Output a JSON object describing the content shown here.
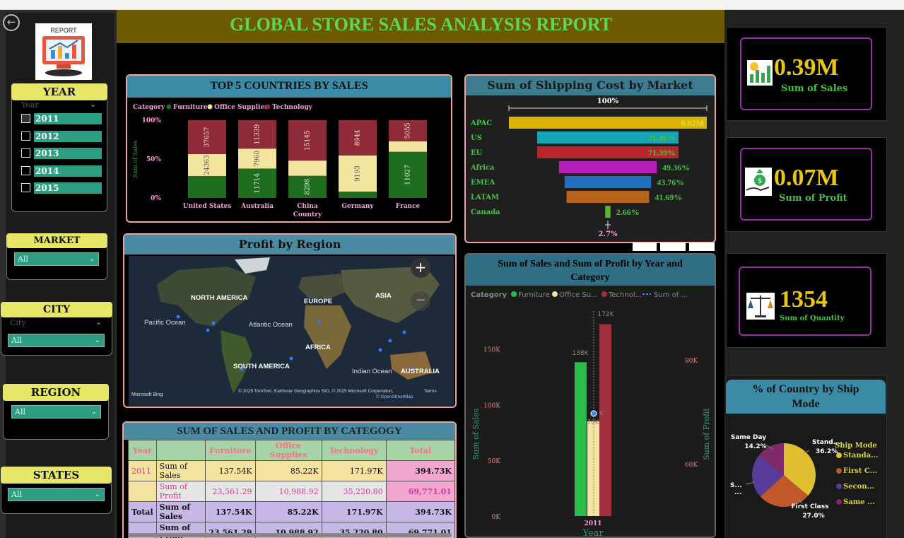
{
  "report_title": "GLOBAL STORE SALES ANALYSIS REPORT",
  "logo_text": "REPORT",
  "slicers": {
    "year": {
      "title": "YEAR",
      "placeholder": "Year",
      "options": [
        "2011",
        "2012",
        "2013",
        "2014",
        "2015"
      ]
    },
    "market": {
      "title": "MARKET",
      "value": "All"
    },
    "city": {
      "title": "CITY",
      "placeholder": "City",
      "value": "All"
    },
    "region": {
      "title": "REGION",
      "value": "All"
    },
    "states": {
      "title": "STATES",
      "value": "All"
    }
  },
  "top5": {
    "title": "TOP 5 COUNTRIES BY SALES",
    "legend_label": "Category",
    "legend": [
      {
        "name": "Furniture",
        "color": "#1f6e1f"
      },
      {
        "name": "Office Supplies",
        "color": "#f3e4a0"
      },
      {
        "name": "Technology",
        "color": "#8f2a38"
      }
    ],
    "ylabel": "Sum of Sales",
    "xlabel": "Country",
    "yticks": [
      "100%",
      "50%",
      "0%"
    ]
  },
  "shipping": {
    "title": "Sum of Shipping Cost by Market",
    "top_label": "100%",
    "bottom_label": "2.7%"
  },
  "map": {
    "title": "Profit by Region",
    "labels": {
      "north_america": "NORTH AMERICA",
      "europe": "EUROPE",
      "asia": "ASIA",
      "pacific": "Pacific Ocean",
      "atlantic": "Atlantic Ocean",
      "africa": "AFRICA",
      "south_america": "SOUTH AMERICA",
      "indian": "Indian Ocean",
      "australia": "AUSTRALIA"
    },
    "attribution": "© 2025 TomTom, Earthstar Geographics SIO, © 2025 Microsoft Corporation,",
    "terms": "Terms",
    "osm": "© OpenStreetMap",
    "brand": "Microsoft Bing",
    "zoom_in": "+",
    "zoom_out": "−"
  },
  "combo": {
    "title": "Sum of Sales and Sum of Profit by Year and Category",
    "legend_label": "Category",
    "legend": [
      {
        "name": "Furniture",
        "color": "#2bbd4a"
      },
      {
        "name": "Office Su...",
        "color": "#f3e4a0"
      },
      {
        "name": "Technol...",
        "color": "#a0303c"
      },
      {
        "name": "Sum of ...",
        "color": "#3a8ef0"
      }
    ],
    "yleft_label": "Sum of Sales",
    "yright_label": "Sum of Profit",
    "yleft_ticks": [
      "150K",
      "100K",
      "50K",
      "0K"
    ],
    "yright_ticks": [
      "80K",
      "60K"
    ],
    "bar_labels": [
      "138K",
      "70K",
      "172K",
      "K"
    ],
    "x_tick": "2011",
    "xlabel": "Year"
  },
  "matrix": {
    "title": "SUM OF SALES AND PROFIT BY CATEGOGY",
    "headers": [
      "Year",
      "",
      "Furniture",
      "Office Supplies",
      "Technology",
      "Total"
    ],
    "rows": [
      [
        "2011",
        "Sum of Sales",
        "137.54K",
        "85.22K",
        "171.97K",
        "394.73K"
      ],
      [
        "",
        "Sum of Profit",
        "23,561.29",
        "10,988.92",
        "35,220.80",
        "69,771.01"
      ],
      [
        "Total",
        "Sum of Sales",
        "137.54K",
        "85.22K",
        "171.97K",
        "394.73K"
      ],
      [
        "",
        "Sum of Profit",
        "23,561.29",
        "10,988.92",
        "35,220.80",
        "69,771.01"
      ]
    ]
  },
  "kpis": [
    {
      "value": "0.39M",
      "label": "Sum of Sales"
    },
    {
      "value": "0.07M",
      "label": "Sum of Profit"
    },
    {
      "value": "1354",
      "label": "Sum of Quantity"
    }
  ],
  "pie": {
    "title": "% of Country by Ship Mode",
    "legend_title": "Ship Mode",
    "callouts": {
      "same_day": "Same Day",
      "same_day_pct": "14.2%",
      "standard": "Stand...",
      "standard_pct": "36.2%",
      "second": "S...",
      "second_pct": "...",
      "first": "First Class",
      "first_pct": "27.0%"
    }
  },
  "chart_data": [
    {
      "type": "bar",
      "title": "TOP 5 COUNTRIES BY SALES",
      "stacked": "100%",
      "xlabel": "Country",
      "ylabel": "Sum of Sales",
      "categories": [
        "United States",
        "Australia",
        "China",
        "Germany",
        "France"
      ],
      "series": [
        {
          "name": "Furniture",
          "values": [
            24363,
            11714,
            8298,
            1600,
            11027
          ]
        },
        {
          "name": "Office Supplies",
          "values": [
            24363,
            7960,
            5700,
            9193,
            2500
          ]
        },
        {
          "name": "Technology",
          "values": [
            37657,
            11339,
            15145,
            8944,
            5055
          ]
        }
      ],
      "value_labels": [
        [
          "",
          "24363",
          "37657"
        ],
        [
          "11714",
          "7960",
          "11339"
        ],
        [
          "8298",
          "",
          "15145"
        ],
        [
          "",
          "9193",
          "8944"
        ],
        [
          "11027",
          "",
          "5055"
        ]
      ]
    },
    {
      "type": "bar",
      "title": "Sum of Shipping Cost by Market",
      "categories": [
        "APAC",
        "US",
        "EU",
        "Africa",
        "EMEA",
        "LATAM",
        "Canada"
      ],
      "values": [
        100,
        71.46,
        71.39,
        49.36,
        43.76,
        41.69,
        2.66
      ],
      "labels": [
        "0.02M",
        "71.46%",
        "71.39%",
        "49.36%",
        "43.76%",
        "41.69%",
        "2.66%"
      ],
      "colors": [
        "#d9b400",
        "#16a3b5",
        "#b8262c",
        "#b51db8",
        "#1f6fbf",
        "#b8631d",
        "#5bb82b"
      ]
    },
    {
      "type": "bar",
      "title": "Sum of Sales and Sum of Profit by Year and Category",
      "categories": [
        "2011"
      ],
      "series": [
        {
          "name": "Furniture",
          "values": [
            138000
          ]
        },
        {
          "name": "Office Supplies",
          "values": [
            85000
          ]
        },
        {
          "name": "Technology",
          "values": [
            172000
          ]
        }
      ],
      "ylim": [
        0,
        175000
      ]
    },
    {
      "type": "pie",
      "title": "% of Country by Ship Mode",
      "categories": [
        "Standard",
        "First Class",
        "Second Class",
        "Same Day"
      ],
      "values": [
        36.2,
        27.0,
        22.6,
        14.2
      ],
      "legend": [
        "Standa...",
        "First C...",
        "Secon...",
        "Same ..."
      ],
      "colors": [
        "#e0c030",
        "#c0582a",
        "#5a3a9a",
        "#802a6a"
      ]
    }
  ]
}
